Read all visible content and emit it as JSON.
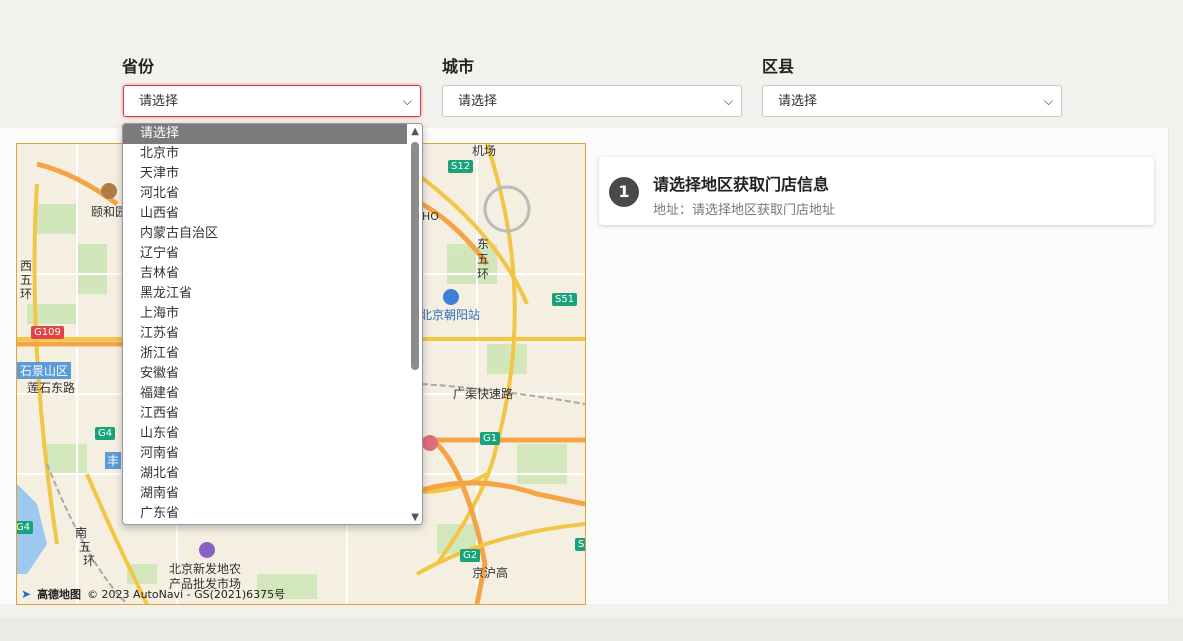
{
  "filters": {
    "province": {
      "label": "省份",
      "value": "请选择"
    },
    "city": {
      "label": "城市",
      "value": "请选择"
    },
    "district": {
      "label": "区县",
      "value": "请选择"
    }
  },
  "dropdown": {
    "options": [
      "请选择",
      "北京市",
      "天津市",
      "河北省",
      "山西省",
      "内蒙古自治区",
      "辽宁省",
      "吉林省",
      "黑龙江省",
      "上海市",
      "江苏省",
      "浙江省",
      "安徽省",
      "福建省",
      "江西省",
      "山东省",
      "河南省",
      "湖北省",
      "湖南省",
      "广东省"
    ],
    "selected": "请选择"
  },
  "map": {
    "labels": {
      "yiheyuan": "颐和园",
      "xiwuhuan_1": "西",
      "xiwuhuan_2": "五",
      "xiwuhuan_3": "环",
      "shijingshan": "石景山区",
      "lianshi": "莲石东路",
      "chaoyang_station": "北京朝阳站",
      "dongwuhuan_1": "东",
      "dongwuhuan_2": "五",
      "dongwuhuan_3": "环",
      "guangqu": "广渠快速路",
      "jichang": "机场",
      "nanwuhuan_1": "南",
      "nanwuhuan_2": "五",
      "nanwuhuan_3": "环",
      "xinfadi_1": "北京新发地农",
      "xinfadi_2": "产品批发市场",
      "jingshen": "京沪高",
      "feng": "丰",
      "fragment_bmo": "HO"
    },
    "shields": {
      "g109": "G109",
      "g4": "G4",
      "g1": "G1",
      "g2": "G2",
      "s12": "S12",
      "s51": "S51",
      "s_edge": "S",
      "g4_edge": "G4"
    },
    "brand": "高德地图",
    "copyright": "© 2023 AutoNavi - GS(2021)6375号"
  },
  "store_card": {
    "index": "1",
    "title": "请选择地区获取门店信息",
    "address": "地址：请选择地区获取门店地址"
  },
  "colors": {
    "accent_red": "#d43a3a",
    "badge": "#4a4a4a",
    "road_major": "#f5a445",
    "road_highway": "#f0c23a",
    "shield_green": "#1aa37a",
    "shield_red": "#e04545"
  }
}
